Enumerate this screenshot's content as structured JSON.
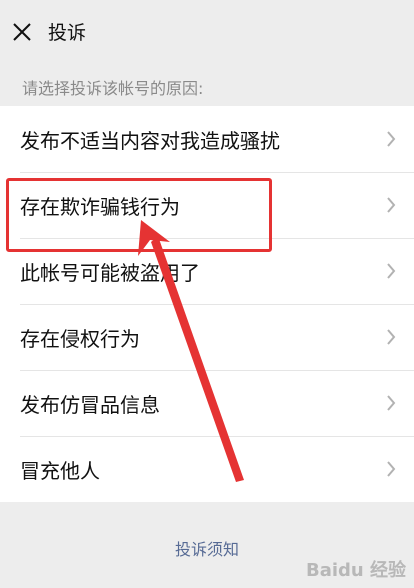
{
  "header": {
    "title": "投诉"
  },
  "hint": "请选择投诉该帐号的原因:",
  "reasons": [
    {
      "label": "发布不适当内容对我造成骚扰"
    },
    {
      "label": "存在欺诈骗钱行为"
    },
    {
      "label": "此帐号可能被盗用了"
    },
    {
      "label": "存在侵权行为"
    },
    {
      "label": "发布仿冒品信息"
    },
    {
      "label": "冒充他人"
    }
  ],
  "footer": {
    "link": "投诉须知"
  },
  "annotation": {
    "color": "#e53333"
  },
  "watermark": "Baidu 经验",
  "colors": {
    "link": "#576b95",
    "background": "#ededed"
  }
}
